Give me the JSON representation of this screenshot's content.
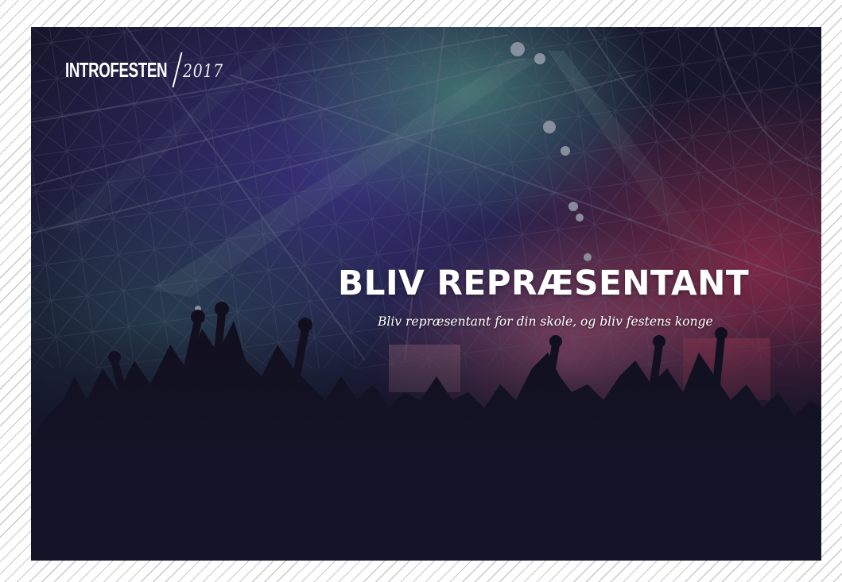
{
  "header": {
    "logo_text": "INTROFESTEN",
    "logo_year": "2017"
  },
  "hero": {
    "title": "BLIV REPRÆSENTANT",
    "subtitle": "Bliv repræsentant for din skole, og bliv festens konge",
    "background_image": "concert-crowd-stage-lights",
    "overlay_color": "#15152a"
  },
  "colors": {
    "page_pattern_light": "#ffffff",
    "page_pattern_stripe": "#c9c9c9",
    "text": "#ffffff",
    "stage_pink": "#d0466a",
    "stage_purple": "#5a4fc4",
    "stage_green": "#5fd39a"
  }
}
